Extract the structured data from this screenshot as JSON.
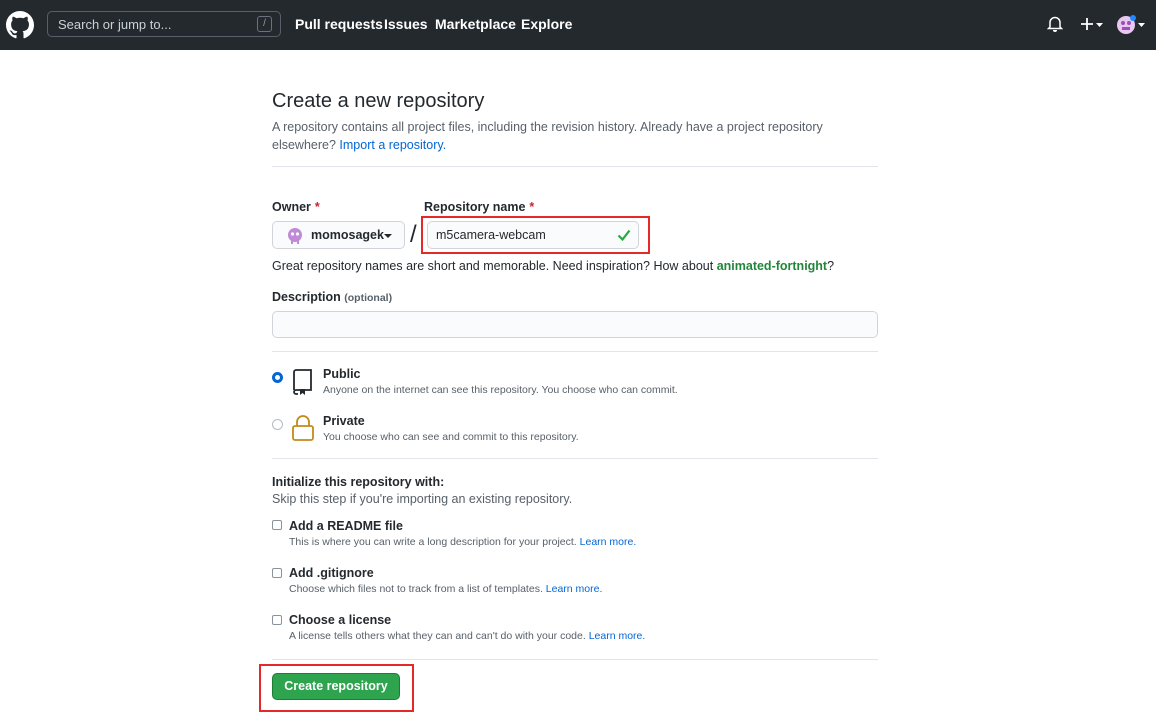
{
  "header": {
    "search_placeholder": "Search or jump to...",
    "search_shortcut": "/",
    "nav": [
      "Pull requests",
      "Issues",
      "Marketplace",
      "Explore"
    ]
  },
  "page": {
    "title": "Create a new repository",
    "subtitle": "A repository contains all project files, including the revision history. Already have a project repository elsewhere?",
    "import_link": "Import a repository."
  },
  "form": {
    "owner_label": "Owner",
    "required_mark": "*",
    "owner_value": "momosagek",
    "separator": "/",
    "repo_label": "Repository name",
    "repo_value": "m5camera-webcam",
    "hint_text": "Great repository names are short and memorable. Need inspiration? How about",
    "hint_suggestion": "animated-fortnight",
    "hint_end": "?",
    "description_label": "Description",
    "description_optional": "(optional)",
    "description_value": "",
    "visibility": {
      "selected": "Public",
      "options": [
        {
          "title": "Public",
          "desc": "Anyone on the internet can see this repository. You choose who can commit."
        },
        {
          "title": "Private",
          "desc": "You choose who can see and commit to this repository."
        }
      ]
    },
    "init_title": "Initialize this repository with:",
    "init_sub": "Skip this step if you're importing an existing repository.",
    "learn_more": "Learn more.",
    "init_options": [
      {
        "title": "Add a README file",
        "desc": "This is where you can write a long description for your project."
      },
      {
        "title": "Add .gitignore",
        "desc": "Choose which files not to track from a list of templates."
      },
      {
        "title": "Choose a license",
        "desc": "A license tells others what they can and can't do with your code."
      }
    ],
    "submit_label": "Create repository"
  },
  "colors": {
    "header_bg": "#24292e",
    "link": "#0366d6",
    "primary_button": "#2ea44f",
    "valid_check": "#28a745",
    "highlight_box": "#e52929",
    "required": "#cb2431"
  },
  "icons": [
    "github-logo-icon",
    "bell-icon",
    "plus-icon",
    "avatar",
    "check-icon",
    "repo-icon",
    "lock-icon"
  ]
}
